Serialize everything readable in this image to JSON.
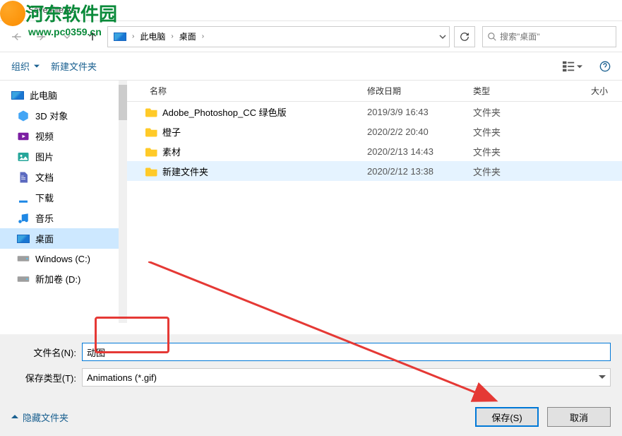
{
  "watermark": {
    "name": "河东软件园",
    "url": "www.pc0359.cn"
  },
  "title": "Save File As",
  "breadcrumb": {
    "root": "此电脑",
    "folder": "桌面"
  },
  "search": {
    "placeholder": "搜索\"桌面\""
  },
  "toolbar": {
    "organize": "组织",
    "new_folder": "新建文件夹"
  },
  "columns": {
    "name": "名称",
    "date": "修改日期",
    "type": "类型",
    "size": "大小"
  },
  "sidebar": [
    {
      "label": "此电脑",
      "icon": "pc",
      "root": true
    },
    {
      "label": "3D 对象",
      "icon": "3d"
    },
    {
      "label": "视频",
      "icon": "video"
    },
    {
      "label": "图片",
      "icon": "picture"
    },
    {
      "label": "文档",
      "icon": "doc"
    },
    {
      "label": "下载",
      "icon": "download"
    },
    {
      "label": "音乐",
      "icon": "music"
    },
    {
      "label": "桌面",
      "icon": "desktop",
      "selected": true
    },
    {
      "label": "Windows (C:)",
      "icon": "drive"
    },
    {
      "label": "新加卷 (D:)",
      "icon": "drive"
    }
  ],
  "files": [
    {
      "name": "Adobe_Photoshop_CC 绿色版",
      "date": "2019/3/9 16:43",
      "type": "文件夹"
    },
    {
      "name": "橙子",
      "date": "2020/2/2 20:40",
      "type": "文件夹"
    },
    {
      "name": "素材",
      "date": "2020/2/13 14:43",
      "type": "文件夹"
    },
    {
      "name": "新建文件夹",
      "date": "2020/2/12 13:38",
      "type": "文件夹",
      "highlight": true
    }
  ],
  "form": {
    "filename_label": "文件名(N):",
    "filename_value": "动图",
    "filetype_label": "保存类型(T):",
    "filetype_value": "Animations (*.gif)"
  },
  "actions": {
    "hide_folders": "隐藏文件夹",
    "save": "保存(S)",
    "cancel": "取消"
  }
}
